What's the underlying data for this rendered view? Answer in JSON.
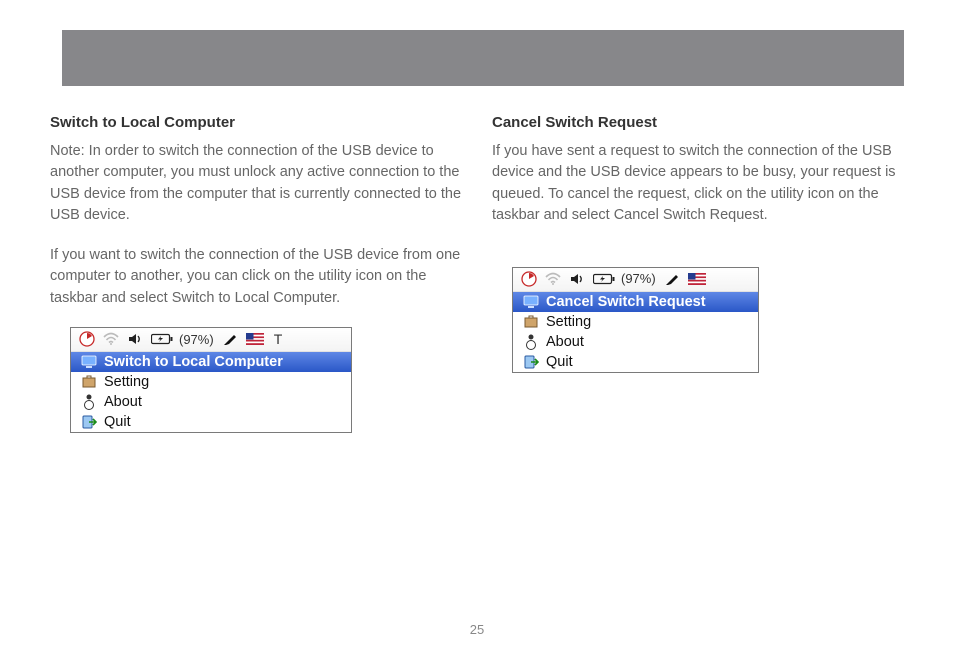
{
  "left": {
    "heading": "Switch to Local Computer",
    "p1": "Note: In order to switch the connection of the USB device to another computer, you must unlock any active connection to the USB device from the computer that is currently connected to the USB device.",
    "p2": "If you want to switch the connection of the USB device from one computer to another, you can click on the utility icon on the taskbar and select Switch to Local Computer."
  },
  "right": {
    "heading": "Cancel Switch Request",
    "p1": "If you have sent a request to switch the connection of the USB device and the USB device appears to be busy, your request is queued.  To cancel the request, click on the utility icon on the taskbar and select Cancel Switch Request."
  },
  "menubar": {
    "battery": "(97%)",
    "extra_letter": "T"
  },
  "menu_left": {
    "item1": "Switch to Local Computer",
    "item2": "Setting",
    "item3": "About",
    "item4": "Quit"
  },
  "menu_right": {
    "item1": "Cancel Switch Request",
    "item2": "Setting",
    "item3": "About",
    "item4": "Quit"
  },
  "page_number": "25"
}
